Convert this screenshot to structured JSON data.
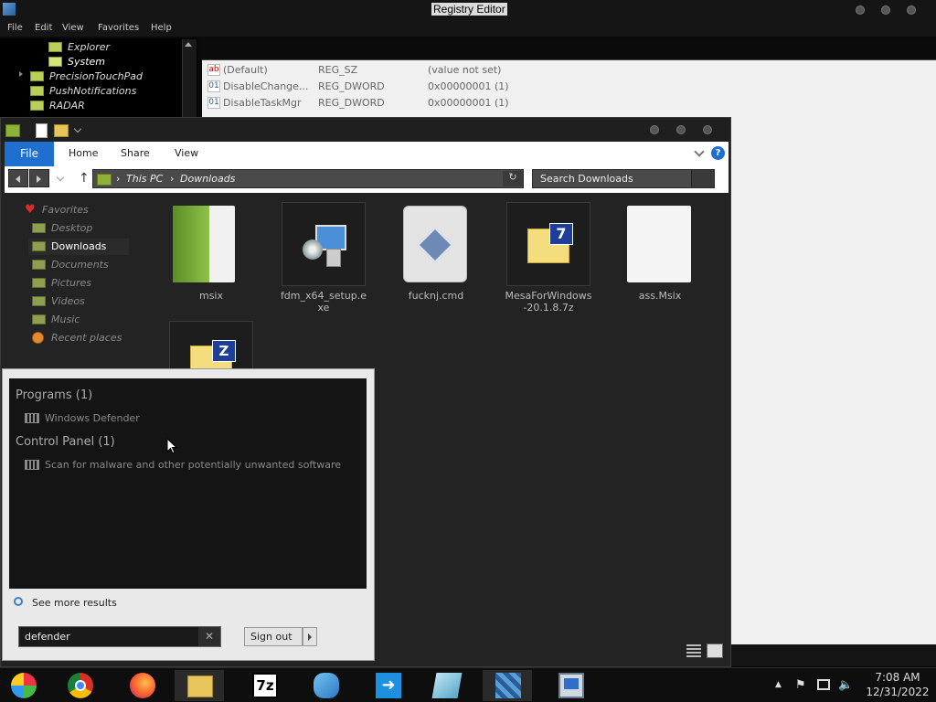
{
  "registry": {
    "title": "Registry Editor",
    "menu": [
      "File",
      "Edit",
      "View",
      "Favorites",
      "Help"
    ],
    "tree": [
      "Explorer",
      "System",
      "PrecisionTouchPad",
      "PushNotifications",
      "RADAR"
    ],
    "rows": [
      {
        "name": "(Default)",
        "type": "REG_SZ",
        "data": "(value not set)"
      },
      {
        "name": "DisableChange...",
        "type": "REG_DWORD",
        "data": "0x00000001 (1)"
      },
      {
        "name": "DisableTaskMgr",
        "type": "REG_DWORD",
        "data": "0x00000001 (1)"
      }
    ]
  },
  "explorer": {
    "ribbon": {
      "file": "File",
      "tabs": [
        "Home",
        "Share",
        "View"
      ],
      "help": "?"
    },
    "path": [
      "This PC",
      "Downloads"
    ],
    "search_placeholder": "Search Downloads",
    "nav": {
      "favorites": "Favorites",
      "items": [
        "Desktop",
        "Downloads",
        "Documents",
        "Pictures",
        "Videos",
        "Music",
        "Recent places"
      ]
    },
    "files": [
      {
        "name": "msix",
        "icon": "folder-icon"
      },
      {
        "name": "fdm_x64_setup.exe",
        "icon": "installer-icon"
      },
      {
        "name": "fucknj.cmd",
        "icon": "cmd-file-icon"
      },
      {
        "name": "MesaForWindows-20.1.8.7z",
        "icon": "7z-archive-icon"
      },
      {
        "name": "ass.Msix",
        "icon": "blank-file-icon"
      },
      {
        "name": "",
        "icon": "zip-archive-icon"
      }
    ]
  },
  "start_menu": {
    "programs_header": "Programs (1)",
    "programs": [
      "Windows Defender"
    ],
    "control_panel_header": "Control Panel (1)",
    "control_panel": [
      "Scan for malware and other potentially unwanted software"
    ],
    "see_more": "See more results",
    "search_value": "defender",
    "clear": "✕",
    "sign_out": "Sign out"
  },
  "taskbar": {
    "apps": [
      "start-icon",
      "chrome-icon",
      "firefox-icon",
      "file-explorer-icon",
      "7zip-icon",
      "network-people-icon",
      "arrow-app-icon",
      "notepad-icon",
      "registry-icon",
      "remote-desktop-icon"
    ],
    "time": "7:08 AM",
    "date": "12/31/2022",
    "tray_chevron": "▲"
  }
}
